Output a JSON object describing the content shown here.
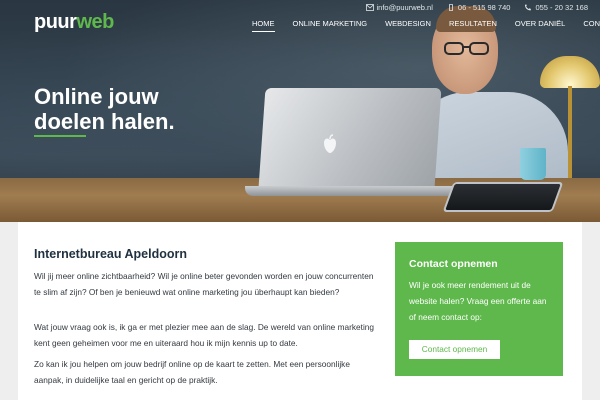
{
  "topbar": {
    "email": "info@puurweb.nl",
    "phone1": "06 - 515 98 740",
    "phone2": "055 - 20 32 168",
    "icons": [
      "envelope-icon",
      "mobile-phone-icon",
      "phone-icon"
    ]
  },
  "logo": {
    "part1": "puur",
    "part2": "web"
  },
  "nav": {
    "items": [
      "HOME",
      "ONLINE MARKETING",
      "WEBDESIGN",
      "RESULTATEN",
      "OVER DANIËL",
      "CONTACT"
    ],
    "active": "HOME"
  },
  "hero": {
    "headline_line1": "Online jouw",
    "headline_line2": "doelen halen."
  },
  "main": {
    "title": "Internetbureau Apeldoorn",
    "p1": "Wil jij meer online zichtbaarheid? Wil je online beter gevonden worden en jouw concurrenten te slim af zijn? Of ben je benieuwd wat online marketing jou überhaupt kan bieden?",
    "p2": "Wat jouw vraag ook is, ik ga er met plezier mee aan de slag. De wereld van online marketing kent geen geheimen voor me en uiteraard hou ik mijn kennis up to date.",
    "p3": "Zo kan ik jou helpen om jouw bedrijf online op de kaart te zetten. Met een persoonlijke aanpak, in duidelijke taal en gericht op de praktijk."
  },
  "contact": {
    "title": "Contact opnemen",
    "text": "Wil je ook meer rendement uit de website halen? Vraag een offerte aan of neem contact op:",
    "button": "Contact opnemen"
  },
  "colors": {
    "brand_green": "#5fb84c",
    "heading_dark": "#1f3140"
  }
}
